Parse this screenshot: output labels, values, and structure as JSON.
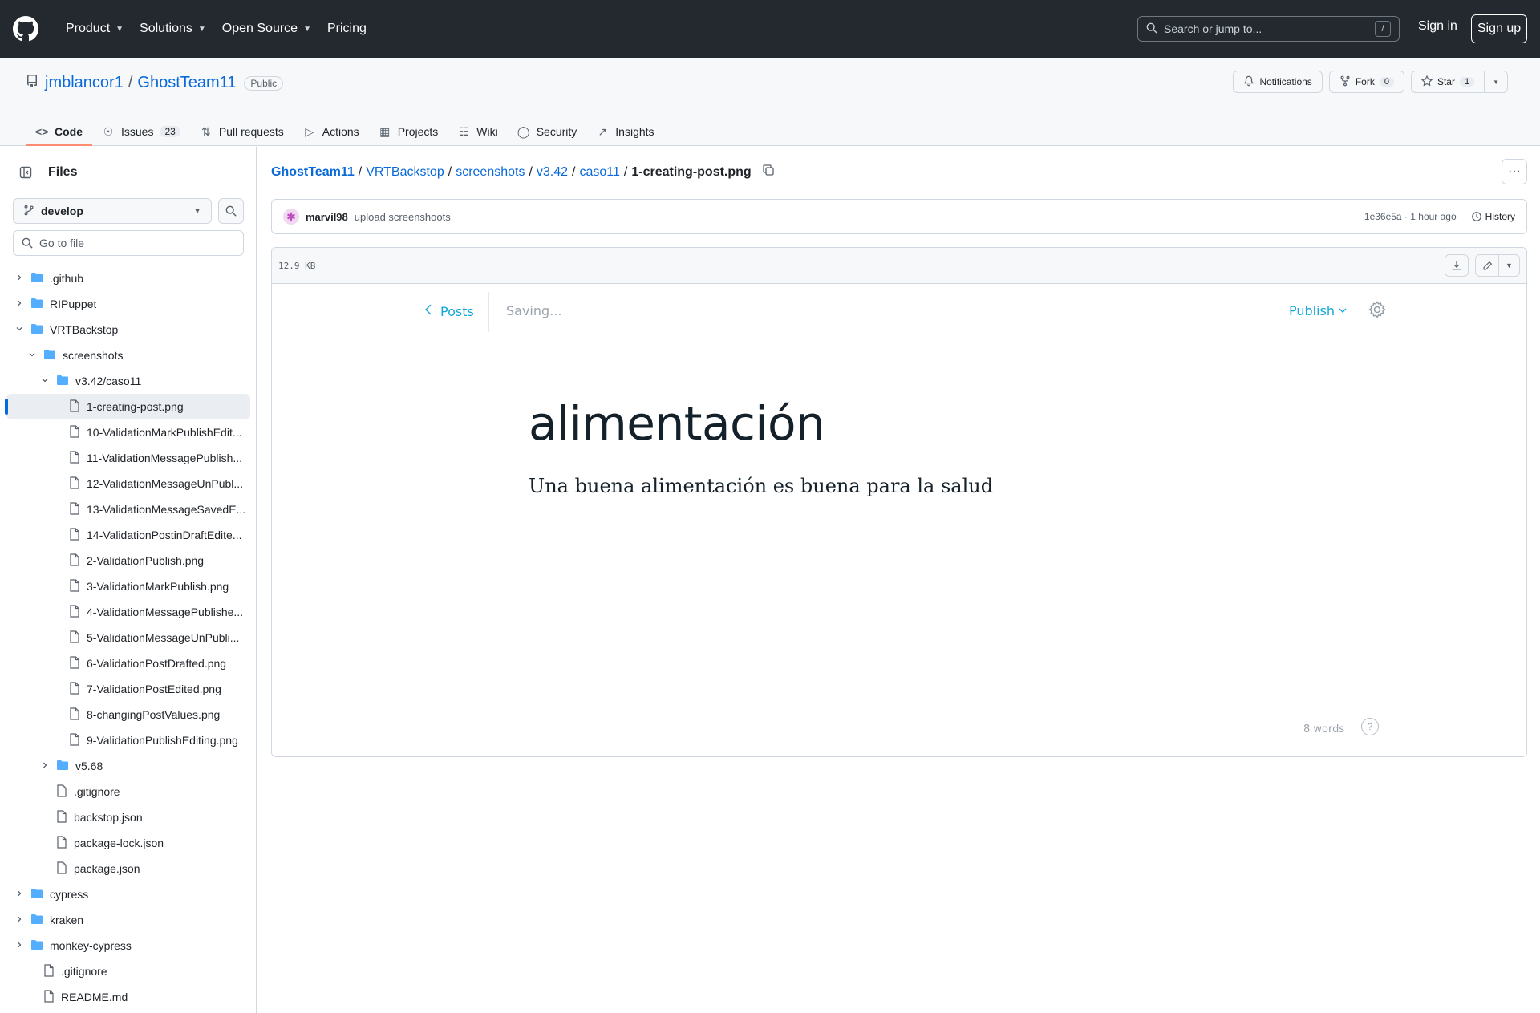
{
  "topbar": {
    "nav": [
      {
        "label": "Product",
        "has_menu": true
      },
      {
        "label": "Solutions",
        "has_menu": true
      },
      {
        "label": "Open Source",
        "has_menu": true
      },
      {
        "label": "Pricing",
        "has_menu": false
      }
    ],
    "search_placeholder": "Search or jump to...",
    "search_shortcut": "/",
    "signin": "Sign in",
    "signup": "Sign up"
  },
  "repo": {
    "owner": "jmblancor1",
    "separator": "/",
    "name": "GhostTeam11",
    "visibility": "Public",
    "notifications": "Notifications",
    "fork_label": "Fork",
    "fork_count": "0",
    "star_label": "Star",
    "star_count": "1",
    "tabs": [
      {
        "label": "Code",
        "icon": "code-icon",
        "active": true
      },
      {
        "label": "Issues",
        "icon": "issue-icon",
        "count": "23"
      },
      {
        "label": "Pull requests",
        "icon": "pull-request-icon"
      },
      {
        "label": "Actions",
        "icon": "play-icon"
      },
      {
        "label": "Projects",
        "icon": "table-icon"
      },
      {
        "label": "Wiki",
        "icon": "book-icon"
      },
      {
        "label": "Security",
        "icon": "shield-icon"
      },
      {
        "label": "Insights",
        "icon": "graph-icon"
      }
    ]
  },
  "sidebar": {
    "title": "Files",
    "branch": "develop",
    "goto_placeholder": "Go to file",
    "tree": [
      {
        "label": ".github",
        "type": "folder",
        "depth": 0,
        "expanded": false
      },
      {
        "label": "RIPuppet",
        "type": "folder",
        "depth": 0,
        "expanded": false
      },
      {
        "label": "VRTBackstop",
        "type": "folder",
        "depth": 0,
        "expanded": true
      },
      {
        "label": "screenshots",
        "type": "folder",
        "depth": 1,
        "expanded": true
      },
      {
        "label": "v3.42/caso11",
        "type": "folder",
        "depth": 2,
        "expanded": true
      },
      {
        "label": "1-creating-post.png",
        "type": "file",
        "depth": 3,
        "selected": true
      },
      {
        "label": "10-ValidationMarkPublishEdit...",
        "type": "file",
        "depth": 3
      },
      {
        "label": "11-ValidationMessagePublish...",
        "type": "file",
        "depth": 3
      },
      {
        "label": "12-ValidationMessageUnPubl...",
        "type": "file",
        "depth": 3
      },
      {
        "label": "13-ValidationMessageSavedE...",
        "type": "file",
        "depth": 3
      },
      {
        "label": "14-ValidationPostinDraftEdite...",
        "type": "file",
        "depth": 3
      },
      {
        "label": "2-ValidationPublish.png",
        "type": "file",
        "depth": 3
      },
      {
        "label": "3-ValidationMarkPublish.png",
        "type": "file",
        "depth": 3
      },
      {
        "label": "4-ValidationMessagePublishe...",
        "type": "file",
        "depth": 3
      },
      {
        "label": "5-ValidationMessageUnPubli...",
        "type": "file",
        "depth": 3
      },
      {
        "label": "6-ValidationPostDrafted.png",
        "type": "file",
        "depth": 3
      },
      {
        "label": "7-ValidationPostEdited.png",
        "type": "file",
        "depth": 3
      },
      {
        "label": "8-changingPostValues.png",
        "type": "file",
        "depth": 3
      },
      {
        "label": "9-ValidationPublishEditing.png",
        "type": "file",
        "depth": 3
      },
      {
        "label": "v5.68",
        "type": "folder",
        "depth": 2,
        "expanded": false
      },
      {
        "label": ".gitignore",
        "type": "file",
        "depth": 2
      },
      {
        "label": "backstop.json",
        "type": "file",
        "depth": 2
      },
      {
        "label": "package-lock.json",
        "type": "file",
        "depth": 2
      },
      {
        "label": "package.json",
        "type": "file",
        "depth": 2
      },
      {
        "label": "cypress",
        "type": "folder",
        "depth": 0,
        "expanded": false
      },
      {
        "label": "kraken",
        "type": "folder",
        "depth": 0,
        "expanded": false
      },
      {
        "label": "monkey-cypress",
        "type": "folder",
        "depth": 0,
        "expanded": false
      },
      {
        "label": ".gitignore",
        "type": "file",
        "depth": 1
      },
      {
        "label": "README.md",
        "type": "file",
        "depth": 1
      }
    ]
  },
  "main": {
    "breadcrumb": [
      "GhostTeam11",
      "VRTBackstop",
      "screenshots",
      "v3.42",
      "caso11"
    ],
    "breadcrumb_sep": "/",
    "current_file": "1-creating-post.png",
    "commit": {
      "author": "marvil98",
      "message": "upload screenshoots",
      "meta": "1e36e5a · 1 hour ago",
      "history": "History"
    },
    "file_size": "12.9 KB"
  },
  "screenshot": {
    "back_label": "Posts",
    "status": "Saving...",
    "publish": "Publish",
    "post_title": "alimentación",
    "post_body": "Una buena alimentación es buena para la salud",
    "word_count": "8 words",
    "help": "?"
  },
  "colors": {
    "header_bg": "#24292f",
    "link": "#0969da",
    "active_tab_underline": "#fd8c73",
    "folder": "#54aeff",
    "ghost_accent": "#14a7d8"
  }
}
